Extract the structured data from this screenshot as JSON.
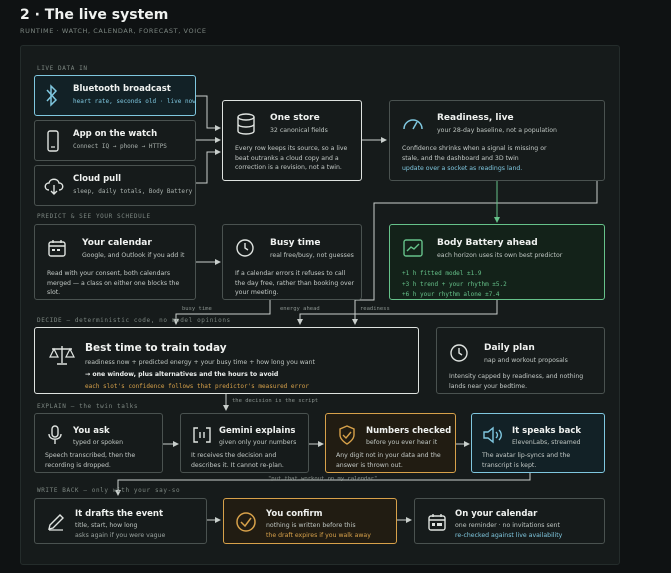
{
  "title": "2 · The live system",
  "subtitle": "RUNTIME · WATCH, CALENDAR, FORECAST, VOICE",
  "sections": {
    "live": "LIVE DATA IN",
    "predict": "PREDICT & SEE YOUR SCHEDULE",
    "decide": "DECIDE — deterministic code, no model opinions",
    "explain": "EXPLAIN — the twin talks",
    "write": "WRITE BACK — only with your say-so"
  },
  "nodes": {
    "bluetooth": {
      "title": "Bluetooth broadcast",
      "sub": "heart rate, seconds old · live now",
      "icon": "bluetooth-icon"
    },
    "watch": {
      "title": "App on the watch",
      "sub": "Connect IQ → phone → HTTPS",
      "icon": "watch-icon"
    },
    "cloud": {
      "title": "Cloud pull",
      "sub": "sleep, daily totals, Body Battery",
      "icon": "cloud-download-icon"
    },
    "store": {
      "title": "One store",
      "sub": "32 canonical fields",
      "body": "Every row keeps its source, so a live beat outranks a cloud copy and a correction is a revision, not a twin.",
      "icon": "database-icon"
    },
    "readiness": {
      "title": "Readiness, live",
      "sub": "your 28-day baseline, not a population",
      "body": "Confidence shrinks when a signal is missing or stale, and the dashboard and 3D twin",
      "link": "update over a socket as readings land.",
      "icon": "gauge-icon"
    },
    "calendar": {
      "title": "Your calendar",
      "sub": "Google, and Outlook if you add it",
      "body": "Read with your consent, both calendars merged — a class on either one blocks the slot.",
      "icon": "calendar-icon"
    },
    "busy": {
      "title": "Busy time",
      "sub": "real free/busy, not guesses",
      "body": "If a calendar errors it refuses to call the day free, rather than booking over your meeting.",
      "icon": "clock-icon"
    },
    "battery": {
      "title": "Body Battery ahead",
      "sub": "each horizon uses its own best predictor",
      "lines": [
        "+1 h fitted model ±1.9",
        "+3 h trend + your rhythm ±5.2",
        "+6 h your rhythm alone ±7.4"
      ],
      "icon": "trend-chart-icon"
    },
    "best": {
      "title": "Best time to train today",
      "sub": "readiness now + predicted energy + your busy time + how long you want",
      "bold": "→ one window, plus alternatives and the hours to avoid",
      "mono": "each slot's confidence follows that predictor's measured error",
      "icon": "scales-icon"
    },
    "daily": {
      "title": "Daily plan",
      "sub": "nap and workout proposals",
      "body": "Intensity capped by readiness, and nothing lands near your bedtime.",
      "icon": "clock-icon"
    },
    "ask": {
      "title": "You ask",
      "sub": "typed or spoken",
      "body": "Speech transcribed, then the recording is dropped.",
      "icon": "microphone-icon"
    },
    "gemini": {
      "title": "Gemini explains",
      "sub": "given only your numbers",
      "body": "It receives the decision and describes it. It cannot re-plan.",
      "icon": "brackets-icon"
    },
    "numbers": {
      "title": "Numbers checked",
      "sub": "before you ever hear it",
      "body": "Any digit not in your data and the answer is thrown out.",
      "icon": "shield-check-icon"
    },
    "speaks": {
      "title": "It speaks back",
      "sub": "ElevenLabs, streamed",
      "body": "The avatar lip-syncs and the transcript is kept.",
      "icon": "speaker-icon"
    },
    "drafts": {
      "title": "It drafts the event",
      "sub": "title, start, how long",
      "sub2": "asks again if you were vague",
      "icon": "pen-icon"
    },
    "confirm": {
      "title": "You confirm",
      "sub": "nothing is written before this",
      "sub2": "the draft expires if you walk away",
      "icon": "check-circle-icon"
    },
    "oncal": {
      "title": "On your calendar",
      "sub": "one reminder · no invitations sent",
      "sub2": "re-checked against live availability",
      "icon": "calendar-check-icon"
    }
  },
  "connectors": {
    "busy_time": "busy time",
    "energy_ahead": "energy ahead",
    "readiness": "readiness",
    "decision_script": "the decision is the script",
    "quote": "\"put that workout on my calendar\""
  },
  "colors": {
    "blue": "#7fc7df",
    "green": "#66c28a",
    "amber": "#d7a14a",
    "line": "#c9cfcc"
  }
}
